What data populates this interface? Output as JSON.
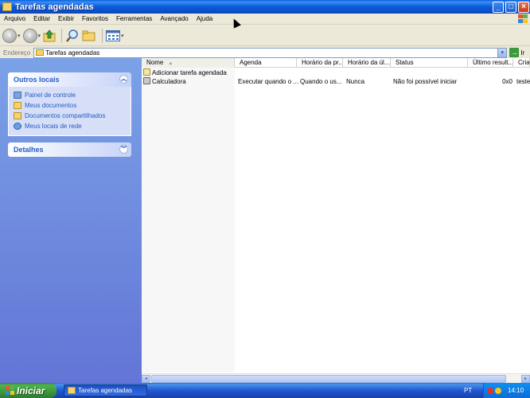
{
  "window": {
    "title": "Tarefas agendadas"
  },
  "menu": [
    "Arquivo",
    "Editar",
    "Exibir",
    "Favoritos",
    "Ferramentas",
    "Avançado",
    "Ajuda"
  ],
  "address": {
    "label": "Endereço",
    "value": "Tarefas agendadas",
    "go_label": "Ir"
  },
  "left_pane": {
    "other_places": {
      "title": "Outros locais",
      "links": [
        {
          "label": "Painel de controle",
          "icon": "control-panel-icon"
        },
        {
          "label": "Meus documentos",
          "icon": "my-documents-icon"
        },
        {
          "label": "Documentos compartilhados",
          "icon": "shared-folder-icon"
        },
        {
          "label": "Meus locais de rede",
          "icon": "network-places-icon"
        }
      ]
    },
    "details": {
      "title": "Detalhes"
    }
  },
  "columns": [
    "Nome",
    "Agenda",
    "Horário da pr...",
    "Horário da úl...",
    "Status",
    "Último result...",
    "Criad"
  ],
  "rows": [
    {
      "name": "Adicionar tarefa agendada",
      "icon": "add-task-icon",
      "schedule": "",
      "next_run": "",
      "last_run": "",
      "status": "",
      "last_result": "",
      "creator": ""
    },
    {
      "name": "Calculadora",
      "icon": "task-icon",
      "schedule": "Executar quando o ...",
      "next_run": "Quando o us...",
      "last_run": "Nunca",
      "status": "Não foi possível iniciar",
      "last_result": "0x0",
      "creator": "teste"
    }
  ],
  "taskbar": {
    "start_label": "Iniciar",
    "task_button": "Tarefas agendadas",
    "language": "PT",
    "clock": "14:10"
  },
  "colors": {
    "titlebar": "#0a5fdc",
    "left_pane_top": "#7ba2e7",
    "left_pane_bottom": "#6375d6",
    "link": "#215dc6",
    "start_button": "#3c983c",
    "taskbar": "#2157d7"
  }
}
